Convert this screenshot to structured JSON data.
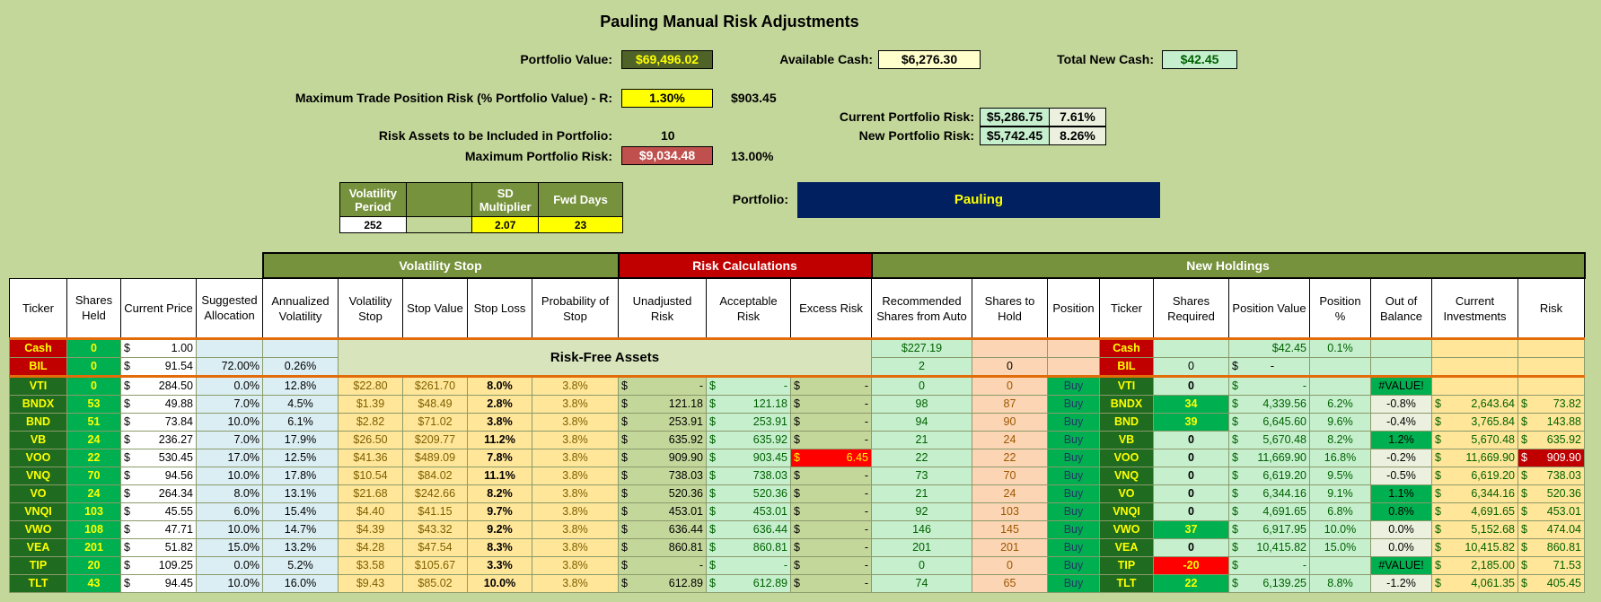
{
  "title": "Pauling Manual Risk Adjustments",
  "header": {
    "portfolio_value_label": "Portfolio Value:",
    "portfolio_value": "$69,496.02",
    "available_cash_label": "Available Cash:",
    "available_cash": "$6,276.30",
    "total_new_cash_label": "Total New Cash:",
    "total_new_cash": "$42.45",
    "max_trade_risk_label": "Maximum Trade Position Risk (% Portfolio Value) - R:",
    "max_trade_risk_pct": "1.30%",
    "max_trade_risk_amount": "$903.45",
    "current_risk_label": "Current Portfolio Risk:",
    "current_risk_amount": "$5,286.75",
    "current_risk_pct": "7.61%",
    "new_risk_label": "New Portfolio Risk:",
    "new_risk_amount": "$5,742.45",
    "new_risk_pct": "8.26%",
    "risk_assets_label": "Risk Assets to be Included in Portfolio:",
    "risk_assets_count": "10",
    "max_portfolio_risk_label": "Maximum Portfolio Risk:",
    "max_portfolio_risk_amount": "$9,034.48",
    "max_portfolio_risk_pct": "13.00%",
    "portfolio_label": "Portfolio:",
    "portfolio_name": "Pauling"
  },
  "params": {
    "h1": "Volatility Period",
    "h2": "",
    "h3": "SD Multiplier",
    "h4": "Fwd Days",
    "v1": "252",
    "v2": "",
    "v3": "2.07",
    "v4": "23"
  },
  "groups": {
    "volatility_stop": "Volatility Stop",
    "risk_calculations": "Risk Calculations",
    "new_holdings": "New Holdings"
  },
  "columns": [
    "Ticker",
    "Shares Held",
    "Current Price",
    "Suggested Allocation",
    "Annualized Volatility",
    "Volatility Stop",
    "Stop Value",
    "Stop Loss",
    "Probability of Stop",
    "Unadjusted Risk",
    "Acceptable Risk",
    "Excess Risk",
    "Recommended Shares from Auto",
    "Shares to Hold",
    "Position",
    "Ticker",
    "Shares Required",
    "Position Value",
    "Position %",
    "Out of Balance",
    "Current Investments",
    "Risk"
  ],
  "risk_free_label": "Risk-Free Assets",
  "cash_row": {
    "ticker": "Cash",
    "shares": "0",
    "price": "1.00",
    "rec": "$227.19",
    "ticker2": "Cash",
    "pos_value": "$42.45",
    "pos_pct": "0.1%"
  },
  "bil_row": {
    "ticker": "BIL",
    "shares": "0",
    "price": "91.54",
    "alloc": "72.00%",
    "vol": "0.26%",
    "rec": "2",
    "hold": "0",
    "ticker2": "BIL",
    "req": "0",
    "pos_value": "-"
  },
  "rows": [
    {
      "ticker": "VTI",
      "shares": "0",
      "price": "284.50",
      "alloc": "0.0%",
      "vol": "12.8%",
      "vstop": "$22.80",
      "stopval": "$261.70",
      "loss": "8.0%",
      "prob": "3.8%",
      "unadj": "-",
      "accept": "-",
      "excess": "-",
      "rec": "0",
      "hold": "0",
      "pos": "Buy",
      "ticker2": "VTI",
      "req": "0",
      "pval": "-",
      "ppct": "",
      "oob": "#VALUE!",
      "curinv": "",
      "risk": ""
    },
    {
      "ticker": "BNDX",
      "shares": "53",
      "price": "49.88",
      "alloc": "7.0%",
      "vol": "4.5%",
      "vstop": "$1.39",
      "stopval": "$48.49",
      "loss": "2.8%",
      "prob": "3.8%",
      "unadj": "121.18",
      "accept": "121.18",
      "excess": "-",
      "rec": "98",
      "hold": "87",
      "pos": "Buy",
      "ticker2": "BNDX",
      "req": "34",
      "pval": "4,339.56",
      "ppct": "6.2%",
      "oob": "-0.8%",
      "curinv": "2,643.64",
      "risk": "73.82"
    },
    {
      "ticker": "BND",
      "shares": "51",
      "price": "73.84",
      "alloc": "10.0%",
      "vol": "6.1%",
      "vstop": "$2.82",
      "stopval": "$71.02",
      "loss": "3.8%",
      "prob": "3.8%",
      "unadj": "253.91",
      "accept": "253.91",
      "excess": "-",
      "rec": "94",
      "hold": "90",
      "pos": "Buy",
      "ticker2": "BND",
      "req": "39",
      "pval": "6,645.60",
      "ppct": "9.6%",
      "oob": "-0.4%",
      "curinv": "3,765.84",
      "risk": "143.88"
    },
    {
      "ticker": "VB",
      "shares": "24",
      "price": "236.27",
      "alloc": "7.0%",
      "vol": "17.9%",
      "vstop": "$26.50",
      "stopval": "$209.77",
      "loss": "11.2%",
      "prob": "3.8%",
      "unadj": "635.92",
      "accept": "635.92",
      "excess": "-",
      "rec": "21",
      "hold": "24",
      "pos": "Buy",
      "ticker2": "VB",
      "req": "0",
      "pval": "5,670.48",
      "ppct": "8.2%",
      "oob": "1.2%",
      "curinv": "5,670.48",
      "risk": "635.92"
    },
    {
      "ticker": "VOO",
      "shares": "22",
      "price": "530.45",
      "alloc": "17.0%",
      "vol": "12.5%",
      "vstop": "$41.36",
      "stopval": "$489.09",
      "loss": "7.8%",
      "prob": "3.8%",
      "unadj": "909.90",
      "accept": "903.45",
      "excess": "6.45",
      "rec": "22",
      "hold": "22",
      "pos": "Buy",
      "ticker2": "VOO",
      "req": "0",
      "pval": "11,669.90",
      "ppct": "16.8%",
      "oob": "-0.2%",
      "curinv": "11,669.90",
      "risk": "909.90"
    },
    {
      "ticker": "VNQ",
      "shares": "70",
      "price": "94.56",
      "alloc": "10.0%",
      "vol": "17.8%",
      "vstop": "$10.54",
      "stopval": "$84.02",
      "loss": "11.1%",
      "prob": "3.8%",
      "unadj": "738.03",
      "accept": "738.03",
      "excess": "-",
      "rec": "73",
      "hold": "70",
      "pos": "Buy",
      "ticker2": "VNQ",
      "req": "0",
      "pval": "6,619.20",
      "ppct": "9.5%",
      "oob": "-0.5%",
      "curinv": "6,619.20",
      "risk": "738.03"
    },
    {
      "ticker": "VO",
      "shares": "24",
      "price": "264.34",
      "alloc": "8.0%",
      "vol": "13.1%",
      "vstop": "$21.68",
      "stopval": "$242.66",
      "loss": "8.2%",
      "prob": "3.8%",
      "unadj": "520.36",
      "accept": "520.36",
      "excess": "-",
      "rec": "21",
      "hold": "24",
      "pos": "Buy",
      "ticker2": "VO",
      "req": "0",
      "pval": "6,344.16",
      "ppct": "9.1%",
      "oob": "1.1%",
      "curinv": "6,344.16",
      "risk": "520.36"
    },
    {
      "ticker": "VNQI",
      "shares": "103",
      "price": "45.55",
      "alloc": "6.0%",
      "vol": "15.4%",
      "vstop": "$4.40",
      "stopval": "$41.15",
      "loss": "9.7%",
      "prob": "3.8%",
      "unadj": "453.01",
      "accept": "453.01",
      "excess": "-",
      "rec": "92",
      "hold": "103",
      "pos": "Buy",
      "ticker2": "VNQI",
      "req": "0",
      "pval": "4,691.65",
      "ppct": "6.8%",
      "oob": "0.8%",
      "curinv": "4,691.65",
      "risk": "453.01"
    },
    {
      "ticker": "VWO",
      "shares": "108",
      "price": "47.71",
      "alloc": "10.0%",
      "vol": "14.7%",
      "vstop": "$4.39",
      "stopval": "$43.32",
      "loss": "9.2%",
      "prob": "3.8%",
      "unadj": "636.44",
      "accept": "636.44",
      "excess": "-",
      "rec": "146",
      "hold": "145",
      "pos": "Buy",
      "ticker2": "VWO",
      "req": "37",
      "pval": "6,917.95",
      "ppct": "10.0%",
      "oob": "0.0%",
      "curinv": "5,152.68",
      "risk": "474.04"
    },
    {
      "ticker": "VEA",
      "shares": "201",
      "price": "51.82",
      "alloc": "15.0%",
      "vol": "13.2%",
      "vstop": "$4.28",
      "stopval": "$47.54",
      "loss": "8.3%",
      "prob": "3.8%",
      "unadj": "860.81",
      "accept": "860.81",
      "excess": "-",
      "rec": "201",
      "hold": "201",
      "pos": "Buy",
      "ticker2": "VEA",
      "req": "0",
      "pval": "10,415.82",
      "ppct": "15.0%",
      "oob": "0.0%",
      "curinv": "10,415.82",
      "risk": "860.81"
    },
    {
      "ticker": "TIP",
      "shares": "20",
      "price": "109.25",
      "alloc": "0.0%",
      "vol": "5.2%",
      "vstop": "$3.58",
      "stopval": "$105.67",
      "loss": "3.3%",
      "prob": "3.8%",
      "unadj": "-",
      "accept": "-",
      "excess": "-",
      "rec": "0",
      "hold": "0",
      "pos": "Buy",
      "ticker2": "TIP",
      "req": "-20",
      "pval": "-",
      "ppct": "",
      "oob": "#VALUE!",
      "curinv": "2,185.00",
      "risk": "71.53"
    },
    {
      "ticker": "TLT",
      "shares": "43",
      "price": "94.45",
      "alloc": "10.0%",
      "vol": "16.0%",
      "vstop": "$9.43",
      "stopval": "$85.02",
      "loss": "10.0%",
      "prob": "3.8%",
      "unadj": "612.89",
      "accept": "612.89",
      "excess": "-",
      "rec": "74",
      "hold": "65",
      "pos": "Buy",
      "ticker2": "TLT",
      "req": "22",
      "pval": "6,139.25",
      "ppct": "8.8%",
      "oob": "-1.2%",
      "curinv": "4,061.35",
      "risk": "405.45"
    }
  ],
  "dollar": "$"
}
